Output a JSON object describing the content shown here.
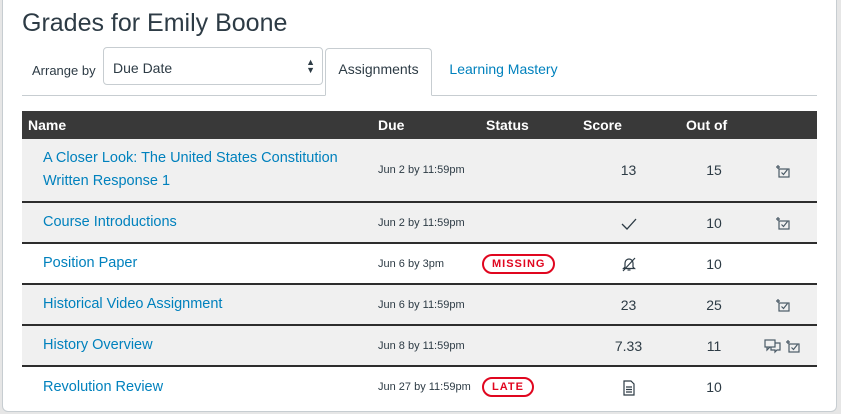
{
  "page": {
    "title": "Grades for Emily Boone"
  },
  "controls": {
    "arrange_label": "Arrange by",
    "arrange_value": "Due Date",
    "tabs": [
      "Assignments",
      "Learning Mastery"
    ]
  },
  "table": {
    "headers": {
      "name": "Name",
      "due": "Due",
      "status": "Status",
      "score": "Score",
      "out_of": "Out of"
    },
    "rows": [
      {
        "name_line1": "A Closer Look: The United States Constitution",
        "name_line2": "Written Response 1",
        "due": "Jun 2 by 11:59pm",
        "status": "",
        "score": "13",
        "score_icon": "",
        "out_of": "15",
        "icons": [
          "rubric-icon"
        ]
      },
      {
        "name_line1": "Course Introductions",
        "name_line2": "",
        "due": "Jun 2 by 11:59pm",
        "status": "",
        "score": "",
        "score_icon": "checkmark-icon",
        "out_of": "10",
        "icons": [
          "rubric-icon"
        ]
      },
      {
        "name_line1": "Position Paper",
        "name_line2": "",
        "due": "Jun 6 by 3pm",
        "status": "MISSING",
        "score": "",
        "score_icon": "muted-bell-icon",
        "out_of": "10",
        "icons": []
      },
      {
        "name_line1": "Historical Video Assignment",
        "name_line2": "",
        "due": "Jun 6 by 11:59pm",
        "status": "",
        "score": "23",
        "score_icon": "",
        "out_of": "25",
        "icons": [
          "rubric-icon"
        ]
      },
      {
        "name_line1": "History Overview",
        "name_line2": "",
        "due": "Jun 8 by 11:59pm",
        "status": "",
        "score": "7.33",
        "score_icon": "",
        "out_of": "11",
        "icons": [
          "comments-icon",
          "rubric-icon"
        ]
      },
      {
        "name_line1": "Revolution Review",
        "name_line2": "",
        "due": "Jun 27 by 11:59pm",
        "status": "LATE",
        "score": "",
        "score_icon": "document-icon",
        "out_of": "10",
        "icons": []
      }
    ]
  },
  "colors": {
    "link": "#0081bd",
    "header_bg": "#393939",
    "status_red": "#e0061f",
    "row_shade": "#f0f0f0"
  }
}
